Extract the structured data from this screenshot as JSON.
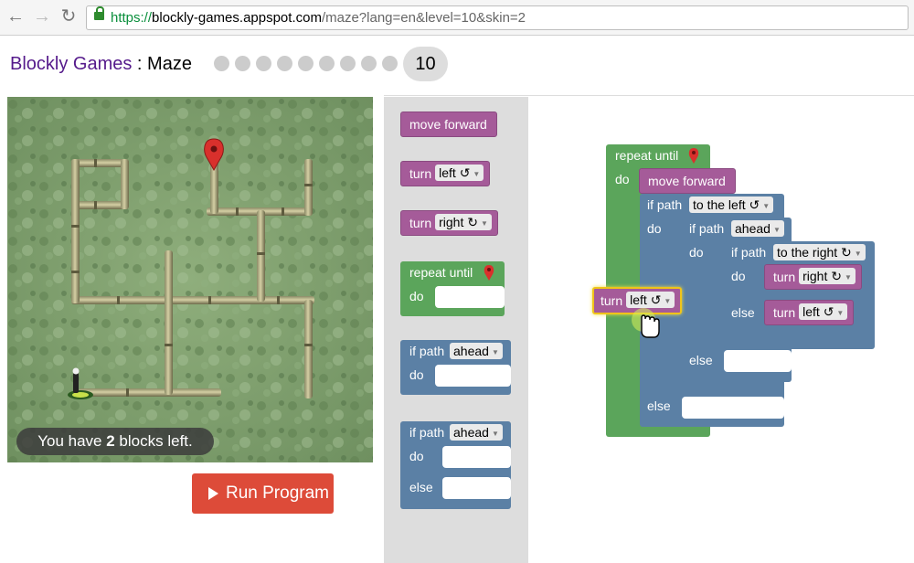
{
  "browser": {
    "url_secure": "https://",
    "url_host": "blockly-games.appspot.com",
    "url_path": "/maze?lang=en&level=10&skin=2",
    "back_icon": "back-arrow-icon",
    "forward_icon": "forward-arrow-icon",
    "reload_icon": "reload-icon",
    "lock_icon": "lock-icon"
  },
  "header": {
    "app_link": "Blockly Games",
    "separator": " : ",
    "game_name": "Maze",
    "level": "10",
    "completed_levels": 0,
    "total_dot_levels": 9
  },
  "maze": {
    "message_prefix": "You have ",
    "blocks_left": "2",
    "message_suffix": " blocks left."
  },
  "run_button": {
    "label": "Run Program"
  },
  "toolbox": {
    "move_forward": "move forward",
    "turn_left_word": "turn",
    "turn_left_value": "left ↺",
    "turn_right_word": "turn",
    "turn_right_value": "right ↻",
    "repeat_until": "repeat until",
    "do": "do",
    "if_path": "if path",
    "if_path_value": "ahead",
    "if_else_path": "if path",
    "if_else_value": "ahead",
    "if_else_do": "do",
    "if_else_else": "else"
  },
  "workspace": {
    "repeat_until": "repeat until",
    "repeat_do": "do",
    "move_forward": "move forward",
    "if1_label": "if path",
    "if1_value": "to the left ↺",
    "if1_do": "do",
    "if1_else": "else",
    "if2_label": "if path",
    "if2_value": "ahead",
    "if2_do": "do",
    "if2_else": "else",
    "if3_label": "if path",
    "if3_value": "to the right ↻",
    "if3_do": "do",
    "if3_else": "else",
    "turn_right_word": "turn",
    "turn_right_value": "right ↻",
    "turn_left_word": "turn",
    "turn_left_value": "left ↺",
    "dragged_turn_word": "turn",
    "dragged_turn_value": "left ↺"
  },
  "colors": {
    "purple_block": "#a55b99",
    "green_block": "#5ba55b",
    "blue_block": "#5b80a5",
    "run_button": "#dd4b39",
    "toolbox_bg": "#dddddd",
    "link_purple": "#551a8b"
  }
}
